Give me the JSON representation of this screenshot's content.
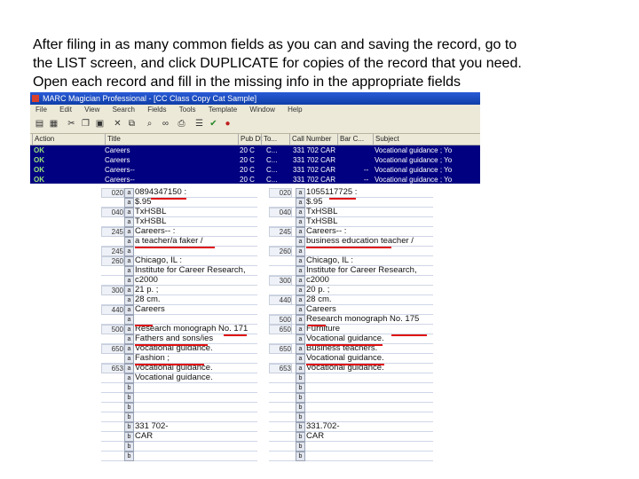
{
  "instructions": [
    "After filing in as many common fields as you can and saving the record, go to",
    "the LIST screen, and click DUPLICATE for copies of the record that you need.",
    "Open each record and fill in the missing info in the appropriate fields"
  ],
  "list_window": {
    "title": "MARC Magician Professional - [CC Class Copy Cat Sample]",
    "menu": [
      "File",
      "Edit",
      "View",
      "Search",
      "Fields",
      "Tools",
      "Template",
      "Window",
      "Help"
    ],
    "columns": [
      "Action",
      "Title",
      "Pub Dt",
      "To...",
      "Call Number",
      "Bar C...",
      "Subject"
    ],
    "rows": [
      {
        "action": "OK",
        "title": "Careers",
        "date": "20 C",
        "to": "C...",
        "call": "331 702 CAR",
        "bar": "",
        "subject": "Vocational guidance ; Yo"
      },
      {
        "action": "OK",
        "title": "Careers",
        "date": "20 C",
        "to": "C...",
        "call": "331 702 CAR",
        "bar": "",
        "subject": "Vocational guidance ; Yo"
      },
      {
        "action": "OK",
        "title": "Careers--",
        "date": "20 C",
        "to": "C...",
        "call": "331 702 CAR",
        "bar": "--",
        "subject": "Vocational guidance ; Yo"
      },
      {
        "action": "OK",
        "title": "Careers--",
        "date": "20 C",
        "to": "C...",
        "call": "331 702 CAR",
        "bar": "--",
        "subject": "Vocational guidance ; Yo"
      }
    ]
  },
  "record_left": {
    "tags": [
      "020",
      "",
      "040",
      "",
      "245",
      "",
      "245",
      "260",
      "",
      "",
      "300",
      "",
      "440",
      "",
      "500",
      "",
      "650",
      "",
      "653",
      "",
      "",
      "",
      "",
      "",
      "",
      "",
      "",
      ""
    ],
    "indicators": [
      "a",
      "a",
      "a",
      "a",
      "a",
      "a",
      "a",
      "a",
      "a",
      "a",
      "a",
      "a",
      "a",
      "a",
      "a",
      "a",
      "a",
      "a",
      "a",
      "a",
      "b",
      "b",
      "b",
      "b",
      "b",
      "b",
      "b",
      "b"
    ],
    "values": [
      "0894347150 :",
      "$.95",
      "TxHSBL",
      "TxHSBL",
      "Careers-- :",
      "a teacher/a faker /",
      "",
      "Chicago, IL :",
      "Institute for Career Research,",
      "c2000",
      "21 p. ;",
      "28 cm.",
      "Careers",
      "",
      "Research monograph No. 171",
      "Fathers and sons/ies",
      "Vocational guidance.",
      "Fashion ;",
      "Vocational guidance.",
      "Vocational guidance.",
      "",
      "",
      "",
      "",
      "331 702-",
      "CAR",
      "",
      ""
    ]
  },
  "record_right": {
    "tags": [
      "020",
      "",
      "040",
      "",
      "245",
      "",
      "260",
      "",
      "",
      "300",
      "",
      "440",
      "",
      "500",
      "650",
      "",
      "650",
      "",
      "653",
      "",
      "",
      "",
      "",
      "",
      "",
      "",
      "",
      ""
    ],
    "indicators": [
      "a",
      "a",
      "a",
      "a",
      "a",
      "a",
      "a",
      "a",
      "a",
      "a",
      "a",
      "a",
      "a",
      "a",
      "a",
      "a",
      "a",
      "a",
      "a",
      "b",
      "b",
      "b",
      "b",
      "b",
      "b",
      "b",
      "b",
      "b"
    ],
    "values": [
      "1055117725 :",
      "$.95",
      "TxHSBL",
      "TxHSBL",
      "Careers-- :",
      "business education teacher /",
      "",
      "Chicago, IL :",
      "Institute for Career Research,",
      "c2000",
      "20 p. ;",
      "28 cm.",
      "Careers",
      "Research monograph No. 175",
      "Furniture",
      "Vocational guidance.",
      "Business teachers.",
      "Vocational guidance.",
      "Vocational guidance.",
      "",
      "",
      "",
      "",
      "",
      "331.702-",
      "CAR",
      "",
      ""
    ]
  },
  "colors": {
    "list_bg": "#000080",
    "ok_green": "#9be27b",
    "underline": "#e01010",
    "titlebar": "#0f3ea8"
  }
}
